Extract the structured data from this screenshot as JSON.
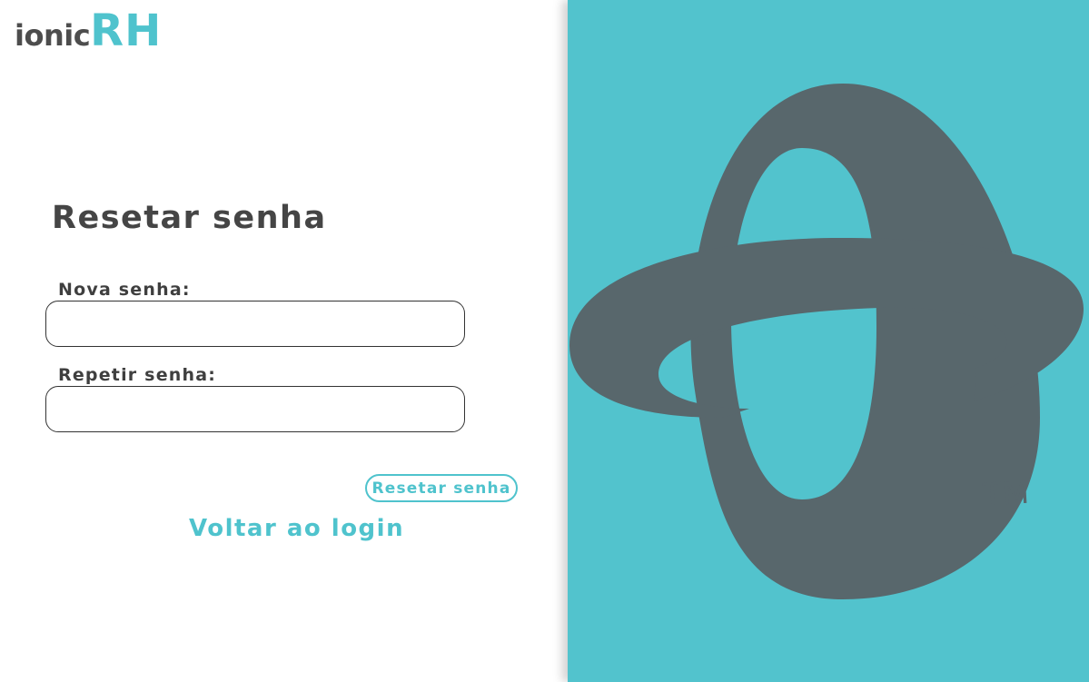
{
  "brand": {
    "prefix": "ionic",
    "suffix": "RH"
  },
  "form": {
    "title": "Resetar senha",
    "new_password_label": "Nova senha:",
    "new_password_value": "",
    "repeat_password_label": "Repetir senha:",
    "repeat_password_value": "",
    "submit_label": "Resetar senha",
    "back_link_label": "Voltar ao login"
  },
  "hero": {
    "trademark": "TM"
  },
  "colors": {
    "accent": "#4fc3cd",
    "panel_background": "#52c3cd",
    "emblem": "#58676c",
    "text_dark": "#454545"
  },
  "icons": {
    "emblem": "orbit-logo-icon"
  }
}
